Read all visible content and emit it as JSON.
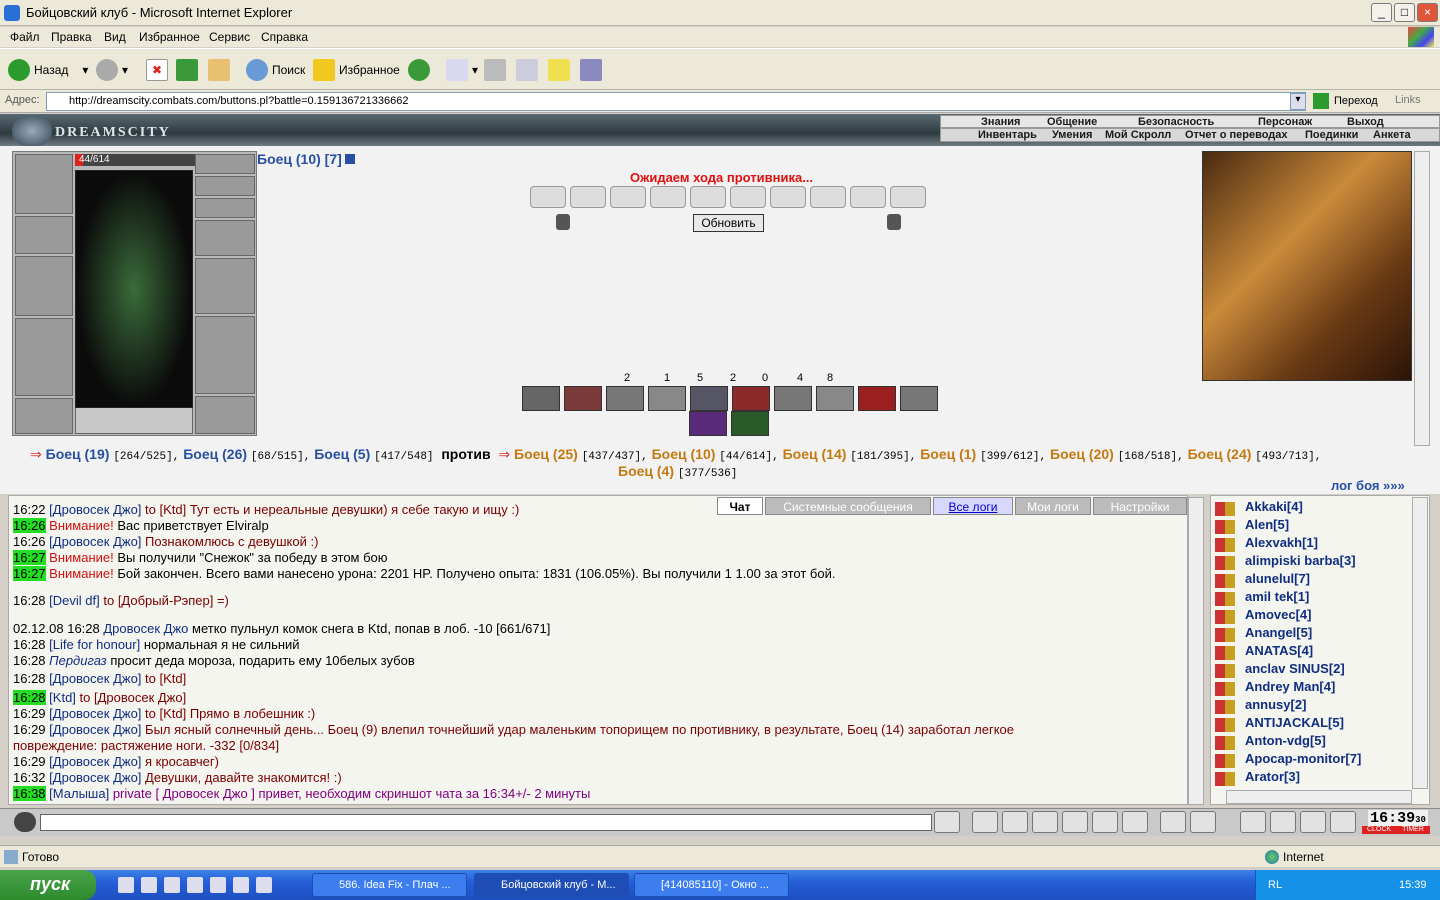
{
  "window": {
    "title": "Бойцовский клуб - Microsoft Internet Explorer"
  },
  "menu": [
    "Файл",
    "Правка",
    "Вид",
    "Избранное",
    "Сервис",
    "Справка"
  ],
  "toolbar": {
    "back": "Назад",
    "search": "Поиск",
    "favorites": "Избранное"
  },
  "address": {
    "label": "Адрес:",
    "url": "http://dreamscity.combats.com/buttons.pl?battle=0.159136721336662",
    "go": "Переход",
    "links": "Links"
  },
  "game": {
    "logo": "DREAMSCITY",
    "nav_top": [
      "Знания",
      "Общение",
      "Безопасность",
      "Персонаж",
      "Выход"
    ],
    "nav_bottom": [
      "Инвентарь",
      "Умения",
      "Мой Скролл",
      "Отчет о переводах",
      "Поединки",
      "Анкета"
    ],
    "hp": "44/614",
    "hp_fraction": 0.07,
    "fighter": "Боец (10) [7]",
    "waiting": "Ожидаем хода противника...",
    "refresh": "Обновить",
    "stats": [
      "2",
      "1",
      "5",
      "2",
      "0",
      "4",
      "8"
    ],
    "team1": [
      {
        "name": "Боец (19)",
        "hp": "[264/525],"
      },
      {
        "name": "Боец (26)",
        "hp": "[68/515],"
      },
      {
        "name": "Боец (5)",
        "hp": "[417/548]"
      }
    ],
    "vs": "против",
    "team2": [
      {
        "name": "Боец (25)",
        "hp": "[437/437],"
      },
      {
        "name": "Боец (10)",
        "hp": "[44/614],"
      },
      {
        "name": "Боец (14)",
        "hp": "[181/395],"
      },
      {
        "name": "Боец (1)",
        "hp": "[399/612],"
      },
      {
        "name": "Боец (20)",
        "hp": "[168/518],"
      },
      {
        "name": "Боец (24)",
        "hp": "[493/713],"
      },
      {
        "name": "Боец (4)",
        "hp": "[377/536]"
      }
    ],
    "battle_log": "лог боя »»»"
  },
  "chat": {
    "tabs": [
      "Чат",
      "Системные сообщения",
      "Все логи",
      "Мои логи",
      "Настройки"
    ],
    "lines": [
      {
        "t": "16:22",
        "who": "[Дровосек Джо]",
        "text": "to [Ktd] Тут есть и нереальные девушки) я себе такую и ищу :)"
      },
      {
        "t": "16:26",
        "who": "Внимание!",
        "text": "Вас приветствует Elviralp"
      },
      {
        "t": "16:26",
        "who": "[Дровосек Джо]",
        "text": "Познакомлюсь с девушкой :)"
      },
      {
        "t": "16:27",
        "who": "Внимание!",
        "text": "Вы получили \"Снежок\" за победу в этом бою"
      },
      {
        "t": "16:27",
        "who": "Внимание!",
        "text": "Бой закончен. Всего вами нанесено урона: 2201 HP. Получено опыта: 1831 (106.05%). Вы получили  1  1.00 за этот бой."
      },
      {
        "t": "16:28",
        "who": "[Devil df]",
        "text": "to [Добрый-Рэпер]        =)"
      },
      {
        "t": "02.12.08 16:28",
        "who": "Дровосек Джо",
        "text": "метко пульнул комок снега в Ktd, попав в лоб. -10 [661/671]"
      },
      {
        "t": "16:28",
        "who": "[Life for honour]",
        "text": "нормальная я не сильний"
      },
      {
        "t": "16:28",
        "who": "Пердигаз",
        "text": "просит деда мороза, подарить ему 10белых зубов"
      },
      {
        "t": "16:28",
        "who": "[Дровосек Джо]",
        "text": "to [Ktd]"
      },
      {
        "t": "16:28",
        "who": "[Ktd]",
        "text": "to [Дровосек Джо]"
      },
      {
        "t": "16:29",
        "who": "[Дровосек Джо]",
        "text": "to [Ktd] Прямо в лобешник :)"
      },
      {
        "t": "16:29",
        "who": "[Дровосек Джо]",
        "text": "Был ясный солнечный день... Боец (9) влепил точнейший удар маленьким топорищем по противнику, в результате, Боец (14) заработал легкое"
      },
      {
        "t": "",
        "who": "",
        "text": "повреждение: растяжение ноги. -332 [0/834]"
      },
      {
        "t": "16:29",
        "who": "[Дровосек Джо]",
        "text": "я кросавчег)"
      },
      {
        "t": "16:32",
        "who": "[Дровосек Джо]",
        "text": "Девушки, давайте знакомится! :)"
      },
      {
        "t": "16:38",
        "who": "[Малыша]",
        "text": "private [ Дровосек Джо ] привет, необходим скриншот чата за 16:34+/- 2 минуты"
      }
    ]
  },
  "users": [
    "Akkaki[4]",
    "Alen[5]",
    "Alexvakh[1]",
    "alimpiski barba[3]",
    "alunelul[7]",
    "amil tek[1]",
    "Amovec[4]",
    "Anangel[5]",
    "ANATAS[4]",
    "anclav SINUS[2]",
    "Andrey Man[4]",
    "annusy[2]",
    "ANTIJACKAL[5]",
    "Anton-vdg[5]",
    "Apocap-monitor[7]",
    "Arator[3]"
  ],
  "clock": "16:39",
  "clock_sec": "30",
  "clock_labels": [
    "CLOCK",
    "TIMER"
  ],
  "status": {
    "text": "Готово",
    "zone": "Internet"
  },
  "taskbar": {
    "start": "пуск",
    "tasks": [
      "586. Idea Fix - Плач ...",
      "Бойцовский клуб - M...",
      "[414085110] - Окно ..."
    ],
    "lang": "RL",
    "time": "15:39"
  },
  "colors": {
    "accent": "#2750a3",
    "enemy": "#c47a12",
    "alert": "#d01010",
    "time_bg": "#22dd22"
  }
}
